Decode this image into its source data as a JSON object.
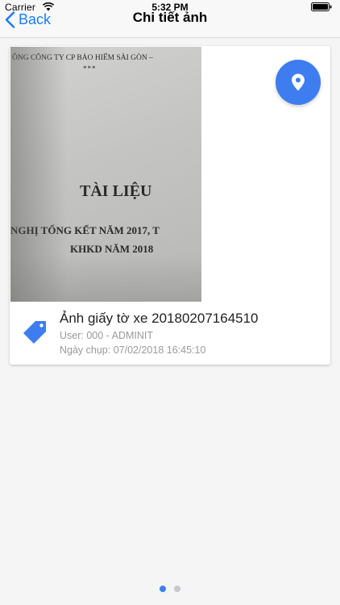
{
  "status_bar": {
    "carrier": "Carrier",
    "time": "5:32 PM"
  },
  "nav": {
    "back_label": "Back",
    "title": "Chi tiết ảnh"
  },
  "photo": {
    "doc_header": "ÔNG CÔNG TY CP BẢO HIỂM SÀI GÒN –",
    "doc_stars": "*** ",
    "doc_title": "TÀI LIỆU",
    "doc_line1": "NGHỊ TỔNG KẾT NĂM 2017, T",
    "doc_line2": "KHKD NĂM 2018"
  },
  "location_button": {
    "icon": "location-pin-icon",
    "color": "#3d7df0"
  },
  "item": {
    "tag_icon": "tag-icon",
    "caption": "Ảnh giấy tờ xe 20180207164510",
    "user": "User: 000 - ADMINIT",
    "date": "Ngày chụp: 07/02/2018 16:45:10"
  },
  "pagination": {
    "pages": 2,
    "current": 1,
    "active_color": "#3d7df0"
  },
  "accent_color": "#1f7cf7"
}
